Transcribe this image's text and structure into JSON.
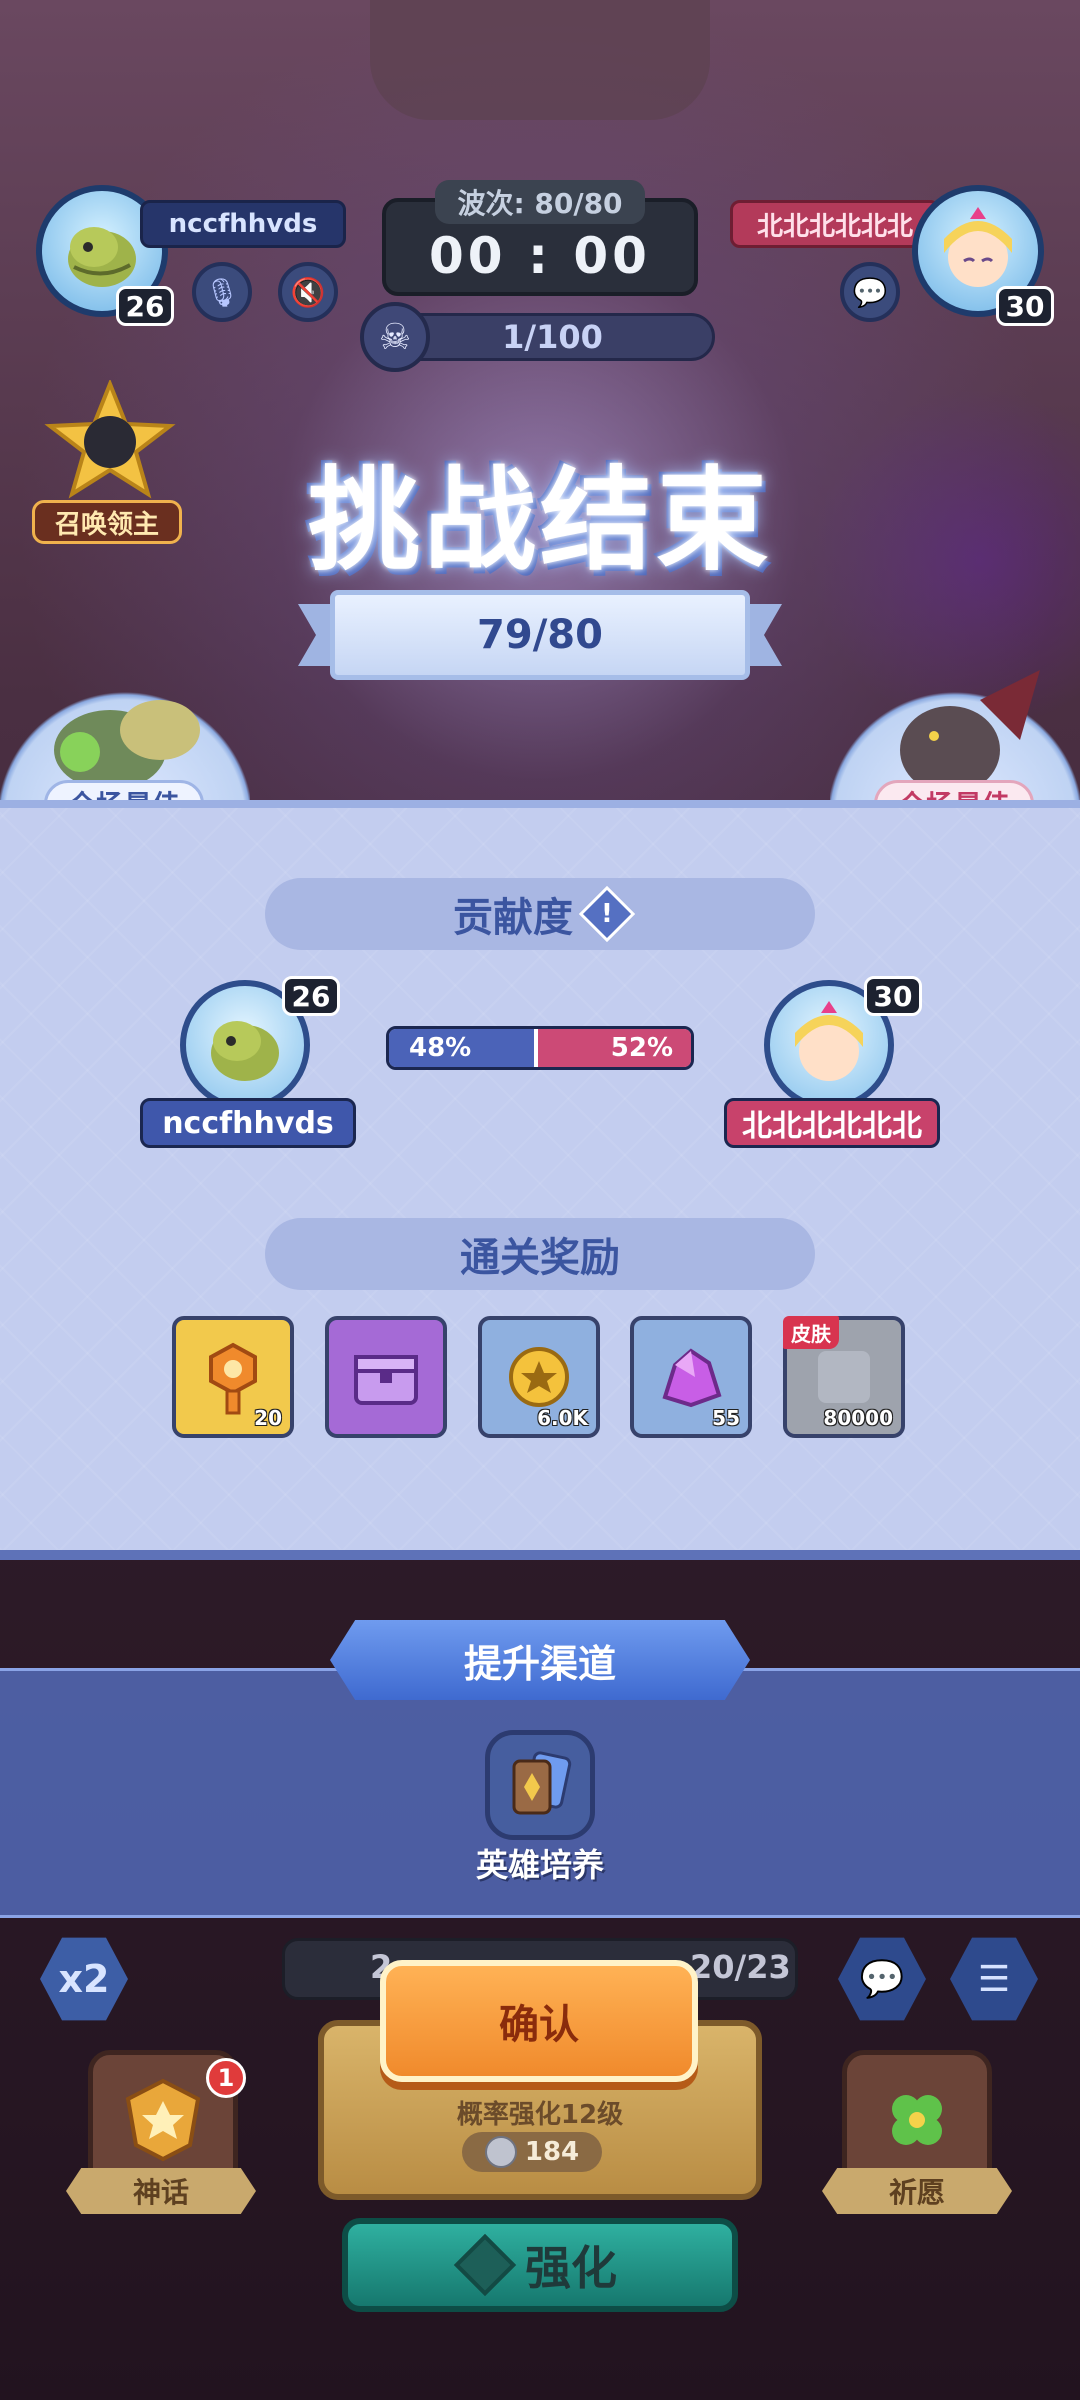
{
  "colors": {
    "blue_team": "#4b63b8",
    "red_team": "#cc4a76",
    "panel_bg": "#c3cdef",
    "confirm_orange": "#f08a2c",
    "strengthen_teal": "#16786e"
  },
  "hud": {
    "player_left": {
      "name": "nccfhhvds",
      "level": "26",
      "avatar_icon": "lizard-hero-icon"
    },
    "player_right": {
      "name": "北北北北北北",
      "level": "30",
      "avatar_icon": "princess-hero-icon"
    },
    "wave_label": "波次: 80/80",
    "timer": "00 : 00",
    "kill_counter": "1/100",
    "summon_lord_label": "召唤领主"
  },
  "result": {
    "title": "挑战结束",
    "score": "79/80",
    "best_left_label": "全场最佳",
    "best_right_label": "全场最佳"
  },
  "contribution": {
    "header": "贡献度",
    "left": {
      "name": "nccfhhvds",
      "level": "26",
      "percent": "48%",
      "fraction": 0.48
    },
    "right": {
      "name": "北北北北北北",
      "level": "30",
      "percent": "52%",
      "fraction": 0.52
    }
  },
  "rewards": {
    "header": "通关奖励",
    "items": [
      {
        "icon": "key-icon",
        "count": "20",
        "bg": "#f2c94c"
      },
      {
        "icon": "treasure-chest-icon",
        "count": "",
        "bg": "#a56ad6"
      },
      {
        "icon": "gold-coin-icon",
        "count": "6.0K",
        "bg": "#8fb0df"
      },
      {
        "icon": "crystal-icon",
        "count": "55",
        "bg": "#8fb0df"
      },
      {
        "icon": "skin-icon",
        "count": "80000",
        "bg": "#9ea3ad",
        "tag": "皮肤"
      }
    ]
  },
  "channel": {
    "title": "提升渠道",
    "item_label": "英雄培养",
    "item_icon": "hero-cards-icon"
  },
  "bottom": {
    "x2_label": "x2",
    "resource_left": "2",
    "resource_right": "20/23",
    "confirm_label": "确认",
    "upgrade_text": "概率强化12级",
    "upgrade_cost": "184",
    "strengthen_label": "强化",
    "myth_label": "神话",
    "myth_badge": "1",
    "wish_label": "祈愿"
  }
}
